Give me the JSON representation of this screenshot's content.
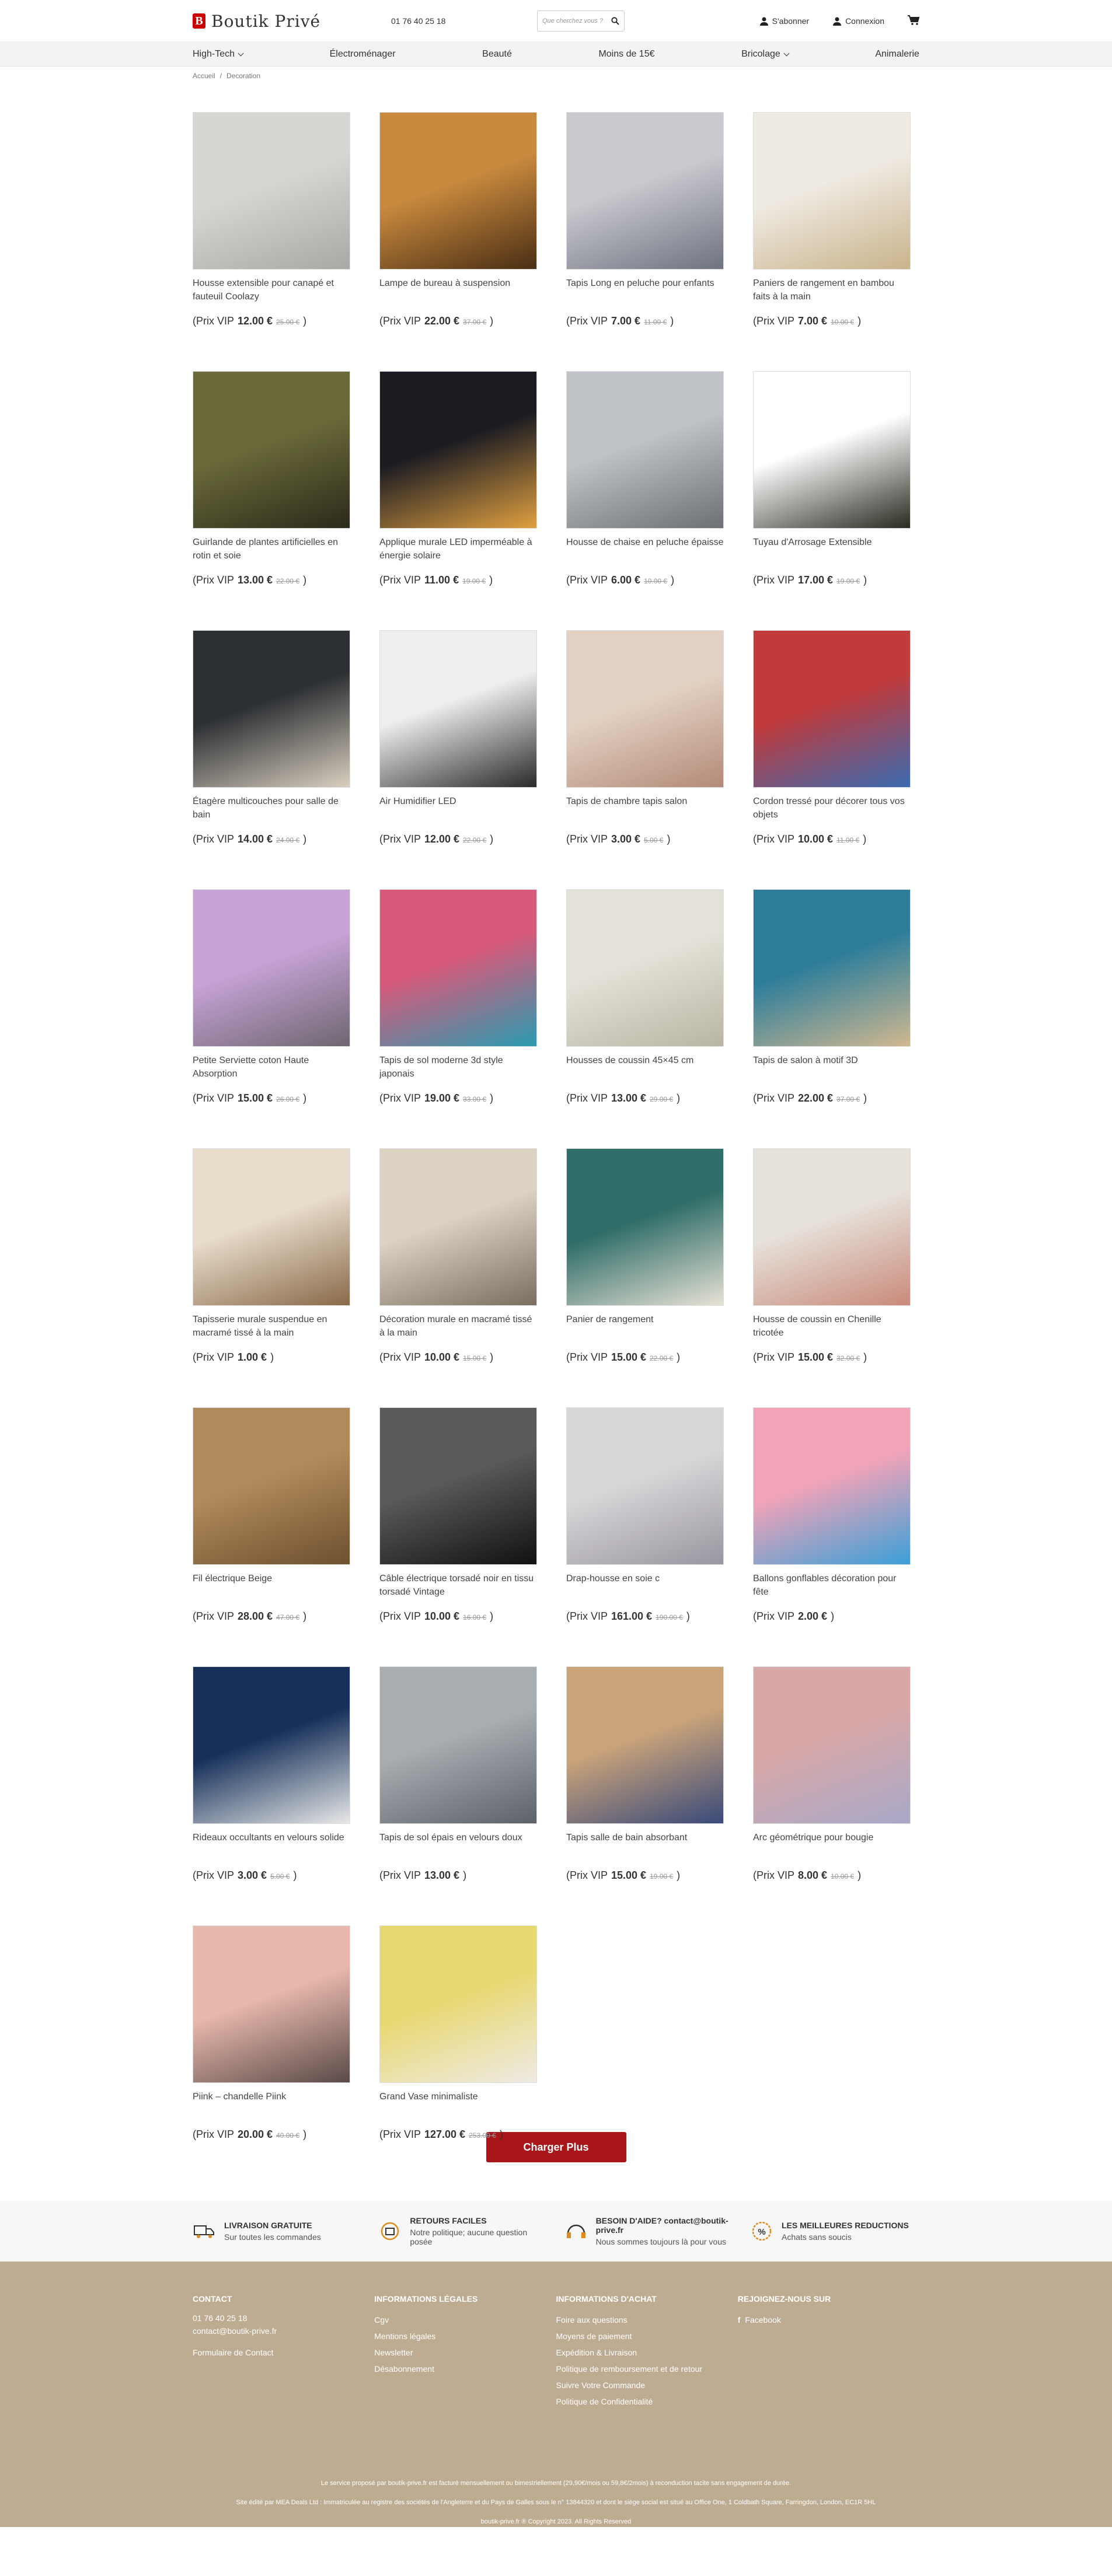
{
  "header": {
    "brand": "Boutik Privé",
    "logo_letter": "B",
    "phone": "01 76 40 25 18",
    "search_placeholder": "Que cherchez vous ?",
    "subscribe": "S'abonner",
    "login": "Connexion"
  },
  "nav": [
    {
      "label": "High-Tech",
      "dropdown": true
    },
    {
      "label": "Électroménager",
      "dropdown": false
    },
    {
      "label": "Beauté",
      "dropdown": false
    },
    {
      "label": "Moins de 15€",
      "dropdown": false
    },
    {
      "label": "Bricolage",
      "dropdown": true
    },
    {
      "label": "Animalerie",
      "dropdown": false
    }
  ],
  "breadcrumb": {
    "home": "Accueil",
    "sep": "/",
    "current": "Decoration"
  },
  "price_prefix": "(Prix VIP",
  "price_suffix": ")",
  "products": [
    {
      "name": "Housse extensible pour canapé et fauteuil Coolazy",
      "price": "12.00 €",
      "old": "25.00 €",
      "c1": "#d8d6d3",
      "c2": "#a9a8a4"
    },
    {
      "name": "Lampe de bureau à suspension",
      "price": "22.00 €",
      "old": "37.00 €",
      "c1": "#c98a3e",
      "c2": "#4a2e14"
    },
    {
      "name": "Tapis Long en peluche pour enfants",
      "price": "7.00 €",
      "old": "11.00 €",
      "c1": "#c9c9cf",
      "c2": "#6f7280"
    },
    {
      "name": "Paniers de rangement en bambou faits à la main",
      "price": "7.00 €",
      "old": "10.00 €",
      "c1": "#efeae2",
      "c2": "#c9b38b"
    },
    {
      "name": "Guirlande de plantes artificielles en rotin et soie",
      "price": "13.00 €",
      "old": "22.00 €",
      "c1": "#6a6a3a",
      "c2": "#2c2a1a"
    },
    {
      "name": "Applique murale LED imperméable à énergie solaire",
      "price": "11.00 €",
      "old": "19.00 €",
      "c1": "#1b1b22",
      "c2": "#e0a040"
    },
    {
      "name": "Housse de chaise en peluche épaisse",
      "price": "6.00 €",
      "old": "10.00 €",
      "c1": "#bfc3c7",
      "c2": "#6c7075"
    },
    {
      "name": "Tuyau d'Arrosage Extensible",
      "price": "17.00 €",
      "old": "19.00 €",
      "c1": "#ffffff",
      "c2": "#2a2a22"
    },
    {
      "name": "Étagère multicouches pour salle de bain",
      "price": "14.00 €",
      "old": "24.00 €",
      "c1": "#2c2f33",
      "c2": "#d9cfc0"
    },
    {
      "name": "Air Humidifier LED",
      "price": "12.00 €",
      "old": "22.00 €",
      "c1": "#eeeeee",
      "c2": "#2a2a2a"
    },
    {
      "name": "Tapis de chambre tapis salon",
      "price": "3.00 €",
      "old": "5.00 €",
      "c1": "#e3d2c3",
      "c2": "#b48a78"
    },
    {
      "name": "Cordon tressé pour décorer tous vos objets",
      "price": "10.00 €",
      "old": "11.00 €",
      "c1": "#c33a3a",
      "c2": "#3a6bb0"
    },
    {
      "name": "Petite Serviette coton Haute Absorption",
      "price": "15.00 €",
      "old": "26.00 €",
      "c1": "#c8a3d8",
      "c2": "#6e6670"
    },
    {
      "name": "Tapis de sol moderne 3d style japonais",
      "price": "19.00 €",
      "old": "33.00 €",
      "c1": "#d75a7b",
      "c2": "#2a9bb0"
    },
    {
      "name": "Housses de coussin 45×45 cm",
      "price": "13.00 €",
      "old": "29.00 €",
      "c1": "#e4e2d8",
      "c2": "#b8b5a4"
    },
    {
      "name": "Tapis de salon à motif 3D",
      "price": "22.00 €",
      "old": "37.00 €",
      "c1": "#2d7d9a",
      "c2": "#d0b890"
    },
    {
      "name": "Tapisserie murale suspendue en macramé tissé à la main",
      "price": "1.00 €",
      "old": "",
      "c1": "#e8dccb",
      "c2": "#8a6a4a"
    },
    {
      "name": "Décoration murale en macramé tissé à la main",
      "price": "10.00 €",
      "old": "15.00 €",
      "c1": "#dcd2c2",
      "c2": "#7b6e60"
    },
    {
      "name": "Panier de rangement",
      "price": "15.00 €",
      "old": "22.00 €",
      "c1": "#2f6d68",
      "c2": "#e8e2d6"
    },
    {
      "name": "Housse de coussin en Chenille tricotée",
      "price": "15.00 €",
      "old": "32.00 €",
      "c1": "#e6e1da",
      "c2": "#c98a7a"
    },
    {
      "name": "Fil électrique Beige",
      "price": "28.00 €",
      "old": "47.00 €",
      "c1": "#b08a5a",
      "c2": "#6e5030"
    },
    {
      "name": "Câble électrique torsadé noir en tissu torsadé Vintage",
      "price": "10.00 €",
      "old": "16.00 €",
      "c1": "#5a5a5a",
      "c2": "#111111"
    },
    {
      "name": "Drap-housse en soie c",
      "price": "161.00 €",
      "old": "190.00 €",
      "c1": "#d8d6d8",
      "c2": "#9a96a0"
    },
    {
      "name": "Ballons gonflables décoration pour fête",
      "price": "2.00 €",
      "old": "",
      "c1": "#f2a3b8",
      "c2": "#3aa0d8"
    },
    {
      "name": "Rideaux occultants en velours solide",
      "price": "3.00 €",
      "old": "5.00 €",
      "c1": "#16305a",
      "c2": "#e8e8e8"
    },
    {
      "name": "Tapis de sol épais en velours doux",
      "price": "13.00 €",
      "old": "",
      "c1": "#a8adb2",
      "c2": "#5d6268"
    },
    {
      "name": "Tapis salle de bain absorbant",
      "price": "15.00 €",
      "old": "19.00 €",
      "c1": "#c9a37a",
      "c2": "#3a4a7a"
    },
    {
      "name": "Arc géométrique pour bougie",
      "price": "8.00 €",
      "old": "10.00 €",
      "c1": "#d8a8a8",
      "c2": "#a8a8c8"
    },
    {
      "name": "Piink – chandelle Piink",
      "price": "20.00 €",
      "old": "40.00 €",
      "c1": "#e8b8ac",
      "c2": "#5a4a48"
    },
    {
      "name": "Grand Vase minimaliste",
      "price": "127.00 €",
      "old": "253.00 €",
      "c1": "#e8d870",
      "c2": "#eeeae4"
    }
  ],
  "load_more": "Charger Plus",
  "features": [
    {
      "icon": "truck-icon",
      "title": "LIVRAISON GRATUITE",
      "sub": "Sur toutes les commandes"
    },
    {
      "icon": "return-icon",
      "title": "RETOURS FACILES",
      "sub": "Notre politique; aucune question posée"
    },
    {
      "icon": "support-icon",
      "title": "BESOIN D'AIDE? contact@boutik-prive.fr",
      "sub": "Nous sommes toujours là pour vous"
    },
    {
      "icon": "discount-icon",
      "title": "LES MEILLEURES REDUCTIONS",
      "sub": "Achats sans soucis"
    }
  ],
  "footer": {
    "contact_title": "CONTACT",
    "contact_phone": "01 76 40 25 18",
    "contact_email": "contact@boutik-prive.fr",
    "contact_form": "Formulaire de Contact",
    "legal_title": "INFORMATIONS LÉGALES",
    "legal": [
      "Cgv",
      "Mentions légales",
      "Newsletter",
      "Désabonnement"
    ],
    "buy_title": "INFORMATIONS D'ACHAT",
    "buy": [
      "Foire aux questions",
      "Moyens de paiement",
      "Expédition & Livraison",
      "Politique de remboursement et de retour",
      "Suivre Votre Commande",
      "Politique de Confidentialité"
    ],
    "join_title": "REJOIGNEZ-NOUS SUR",
    "facebook": "Facebook",
    "note1": "Le service proposé par boutik-prive.fr est facturé mensuellement ou bimestriellement (29,90€/mois ou 59,8€/2mois) à reconduction tacite sans engagement de durée.",
    "note2": "Site édité par MEA Deals Ltd : Immatriculée au registre des sociétés de l'Angleterre et du Pays de Galles sous le n° 13844320 et dont le siège social est situé au Office One, 1 Coldbath Square, Farringdon, London, EC1R 5HL",
    "note3": "boutik-prive.fr ® Copyright 2023. All Rights Reserved"
  }
}
